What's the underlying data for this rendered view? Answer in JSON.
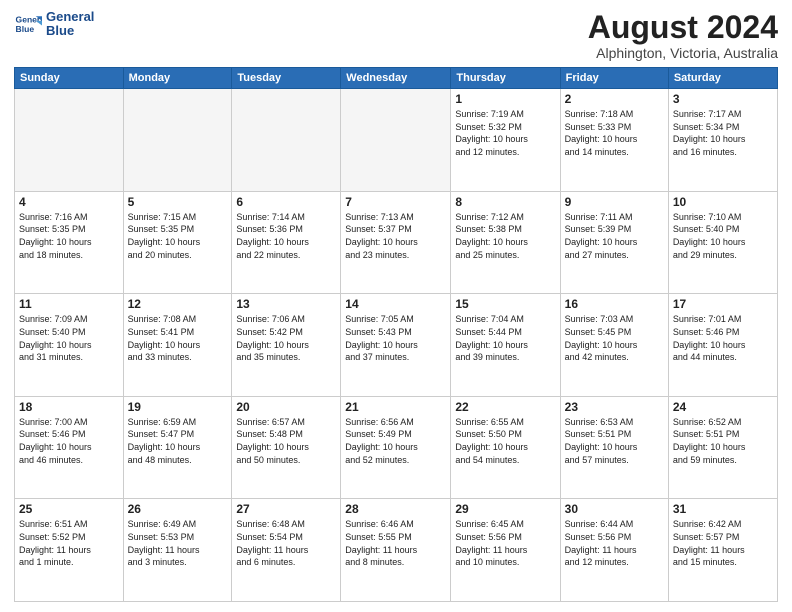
{
  "header": {
    "logo_line1": "General",
    "logo_line2": "Blue",
    "month_title": "August 2024",
    "subtitle": "Alphington, Victoria, Australia"
  },
  "weekdays": [
    "Sunday",
    "Monday",
    "Tuesday",
    "Wednesday",
    "Thursday",
    "Friday",
    "Saturday"
  ],
  "weeks": [
    [
      {
        "day": "",
        "info": ""
      },
      {
        "day": "",
        "info": ""
      },
      {
        "day": "",
        "info": ""
      },
      {
        "day": "",
        "info": ""
      },
      {
        "day": "1",
        "info": "Sunrise: 7:19 AM\nSunset: 5:32 PM\nDaylight: 10 hours\nand 12 minutes."
      },
      {
        "day": "2",
        "info": "Sunrise: 7:18 AM\nSunset: 5:33 PM\nDaylight: 10 hours\nand 14 minutes."
      },
      {
        "day": "3",
        "info": "Sunrise: 7:17 AM\nSunset: 5:34 PM\nDaylight: 10 hours\nand 16 minutes."
      }
    ],
    [
      {
        "day": "4",
        "info": "Sunrise: 7:16 AM\nSunset: 5:35 PM\nDaylight: 10 hours\nand 18 minutes."
      },
      {
        "day": "5",
        "info": "Sunrise: 7:15 AM\nSunset: 5:35 PM\nDaylight: 10 hours\nand 20 minutes."
      },
      {
        "day": "6",
        "info": "Sunrise: 7:14 AM\nSunset: 5:36 PM\nDaylight: 10 hours\nand 22 minutes."
      },
      {
        "day": "7",
        "info": "Sunrise: 7:13 AM\nSunset: 5:37 PM\nDaylight: 10 hours\nand 23 minutes."
      },
      {
        "day": "8",
        "info": "Sunrise: 7:12 AM\nSunset: 5:38 PM\nDaylight: 10 hours\nand 25 minutes."
      },
      {
        "day": "9",
        "info": "Sunrise: 7:11 AM\nSunset: 5:39 PM\nDaylight: 10 hours\nand 27 minutes."
      },
      {
        "day": "10",
        "info": "Sunrise: 7:10 AM\nSunset: 5:40 PM\nDaylight: 10 hours\nand 29 minutes."
      }
    ],
    [
      {
        "day": "11",
        "info": "Sunrise: 7:09 AM\nSunset: 5:40 PM\nDaylight: 10 hours\nand 31 minutes."
      },
      {
        "day": "12",
        "info": "Sunrise: 7:08 AM\nSunset: 5:41 PM\nDaylight: 10 hours\nand 33 minutes."
      },
      {
        "day": "13",
        "info": "Sunrise: 7:06 AM\nSunset: 5:42 PM\nDaylight: 10 hours\nand 35 minutes."
      },
      {
        "day": "14",
        "info": "Sunrise: 7:05 AM\nSunset: 5:43 PM\nDaylight: 10 hours\nand 37 minutes."
      },
      {
        "day": "15",
        "info": "Sunrise: 7:04 AM\nSunset: 5:44 PM\nDaylight: 10 hours\nand 39 minutes."
      },
      {
        "day": "16",
        "info": "Sunrise: 7:03 AM\nSunset: 5:45 PM\nDaylight: 10 hours\nand 42 minutes."
      },
      {
        "day": "17",
        "info": "Sunrise: 7:01 AM\nSunset: 5:46 PM\nDaylight: 10 hours\nand 44 minutes."
      }
    ],
    [
      {
        "day": "18",
        "info": "Sunrise: 7:00 AM\nSunset: 5:46 PM\nDaylight: 10 hours\nand 46 minutes."
      },
      {
        "day": "19",
        "info": "Sunrise: 6:59 AM\nSunset: 5:47 PM\nDaylight: 10 hours\nand 48 minutes."
      },
      {
        "day": "20",
        "info": "Sunrise: 6:57 AM\nSunset: 5:48 PM\nDaylight: 10 hours\nand 50 minutes."
      },
      {
        "day": "21",
        "info": "Sunrise: 6:56 AM\nSunset: 5:49 PM\nDaylight: 10 hours\nand 52 minutes."
      },
      {
        "day": "22",
        "info": "Sunrise: 6:55 AM\nSunset: 5:50 PM\nDaylight: 10 hours\nand 54 minutes."
      },
      {
        "day": "23",
        "info": "Sunrise: 6:53 AM\nSunset: 5:51 PM\nDaylight: 10 hours\nand 57 minutes."
      },
      {
        "day": "24",
        "info": "Sunrise: 6:52 AM\nSunset: 5:51 PM\nDaylight: 10 hours\nand 59 minutes."
      }
    ],
    [
      {
        "day": "25",
        "info": "Sunrise: 6:51 AM\nSunset: 5:52 PM\nDaylight: 11 hours\nand 1 minute."
      },
      {
        "day": "26",
        "info": "Sunrise: 6:49 AM\nSunset: 5:53 PM\nDaylight: 11 hours\nand 3 minutes."
      },
      {
        "day": "27",
        "info": "Sunrise: 6:48 AM\nSunset: 5:54 PM\nDaylight: 11 hours\nand 6 minutes."
      },
      {
        "day": "28",
        "info": "Sunrise: 6:46 AM\nSunset: 5:55 PM\nDaylight: 11 hours\nand 8 minutes."
      },
      {
        "day": "29",
        "info": "Sunrise: 6:45 AM\nSunset: 5:56 PM\nDaylight: 11 hours\nand 10 minutes."
      },
      {
        "day": "30",
        "info": "Sunrise: 6:44 AM\nSunset: 5:56 PM\nDaylight: 11 hours\nand 12 minutes."
      },
      {
        "day": "31",
        "info": "Sunrise: 6:42 AM\nSunset: 5:57 PM\nDaylight: 11 hours\nand 15 minutes."
      }
    ]
  ]
}
